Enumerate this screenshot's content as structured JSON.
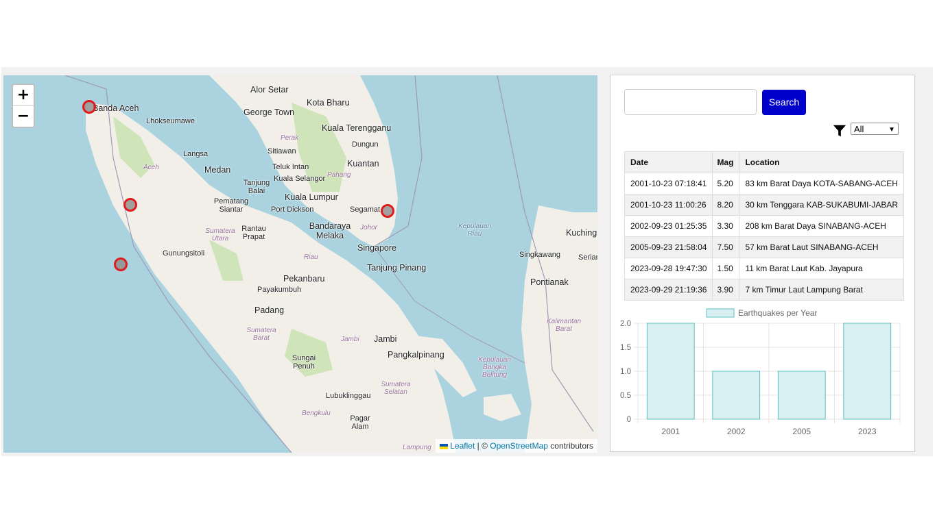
{
  "map": {
    "zoom_in": "+",
    "zoom_out": "−",
    "attribution": {
      "leaflet": "Leaflet",
      "sep": " | © ",
      "osm": "OpenStreetMap",
      "suffix": " contributors"
    },
    "places": [
      "Alor Setar",
      "Kota Bharu",
      "George Town",
      "Banda Aceh",
      "Lhokseumawe",
      "Kuala Terengganu",
      "Perak",
      "Dungun",
      "Langsa",
      "Sitiawan",
      "Kuantan",
      "Teluk Intan",
      "Medan",
      "Pahang",
      "Kuala Selangor",
      "Aceh",
      "Tanjung Balai",
      "Kuala Lumpur",
      "Pematang Siantar",
      "Port Dickson",
      "Segamat",
      "Bandaraya Melaka",
      "Johor",
      "Kepulauan Riau",
      "Kuching",
      "Rantau Prapat",
      "Sumatera Utara",
      "Singapore",
      "Gunungsitoli",
      "Riau",
      "Singkawang",
      "Serian",
      "Tanjung Pinang",
      "Pekanbaru",
      "Pontianak",
      "Payakumbuh",
      "Padang",
      "Kalimantan Barat",
      "Sumatera Barat",
      "Jambi",
      "Jambi",
      "Pangkalpinang",
      "Sungai Penuh",
      "Kepulauan Bangka Belitung",
      "Sumatera Selatan",
      "Lubuklinggau",
      "Bengkulu",
      "Pagar Alam",
      "Lampung"
    ]
  },
  "search": {
    "placeholder": "",
    "button_label": "Search"
  },
  "filter": {
    "icon": "filter-icon",
    "selected": "All"
  },
  "table": {
    "headers": [
      "Date",
      "Mag",
      "Location"
    ],
    "rows": [
      [
        "2001-10-23 07:18:41",
        "5.20",
        "83 km Barat Daya KOTA-SABANG-ACEH"
      ],
      [
        "2001-10-23 11:00:26",
        "8.20",
        "30 km Tenggara KAB-SUKABUMI-JABAR"
      ],
      [
        "2002-09-23 01:25:35",
        "3.30",
        "208 km Barat Daya SINABANG-ACEH"
      ],
      [
        "2005-09-23 21:58:04",
        "7.50",
        "57 km Barat Laut SINABANG-ACEH"
      ],
      [
        "2023-09-28 19:47:30",
        "1.50",
        "11 km Barat Laut Kab. Jayapura"
      ],
      [
        "2023-09-29 21:19:36",
        "3.90",
        "7 km Timur Laut Lampung Barat"
      ]
    ]
  },
  "chart_data": {
    "type": "bar",
    "categories": [
      "2001",
      "2002",
      "2005",
      "2023"
    ],
    "series": [
      {
        "name": "Earthquakes per Year",
        "values": [
          2,
          1,
          1,
          2
        ]
      }
    ],
    "ylim": [
      0,
      2
    ],
    "yticks": [
      "2.0",
      "1.5",
      "1.0",
      "0.5",
      "0"
    ],
    "colors": {
      "fill": "#d8f0f2",
      "stroke": "#5fbfbf"
    },
    "legend": "top"
  },
  "colors": {
    "search_button": "#0000cc",
    "marker_stroke": "#e31a1c"
  }
}
